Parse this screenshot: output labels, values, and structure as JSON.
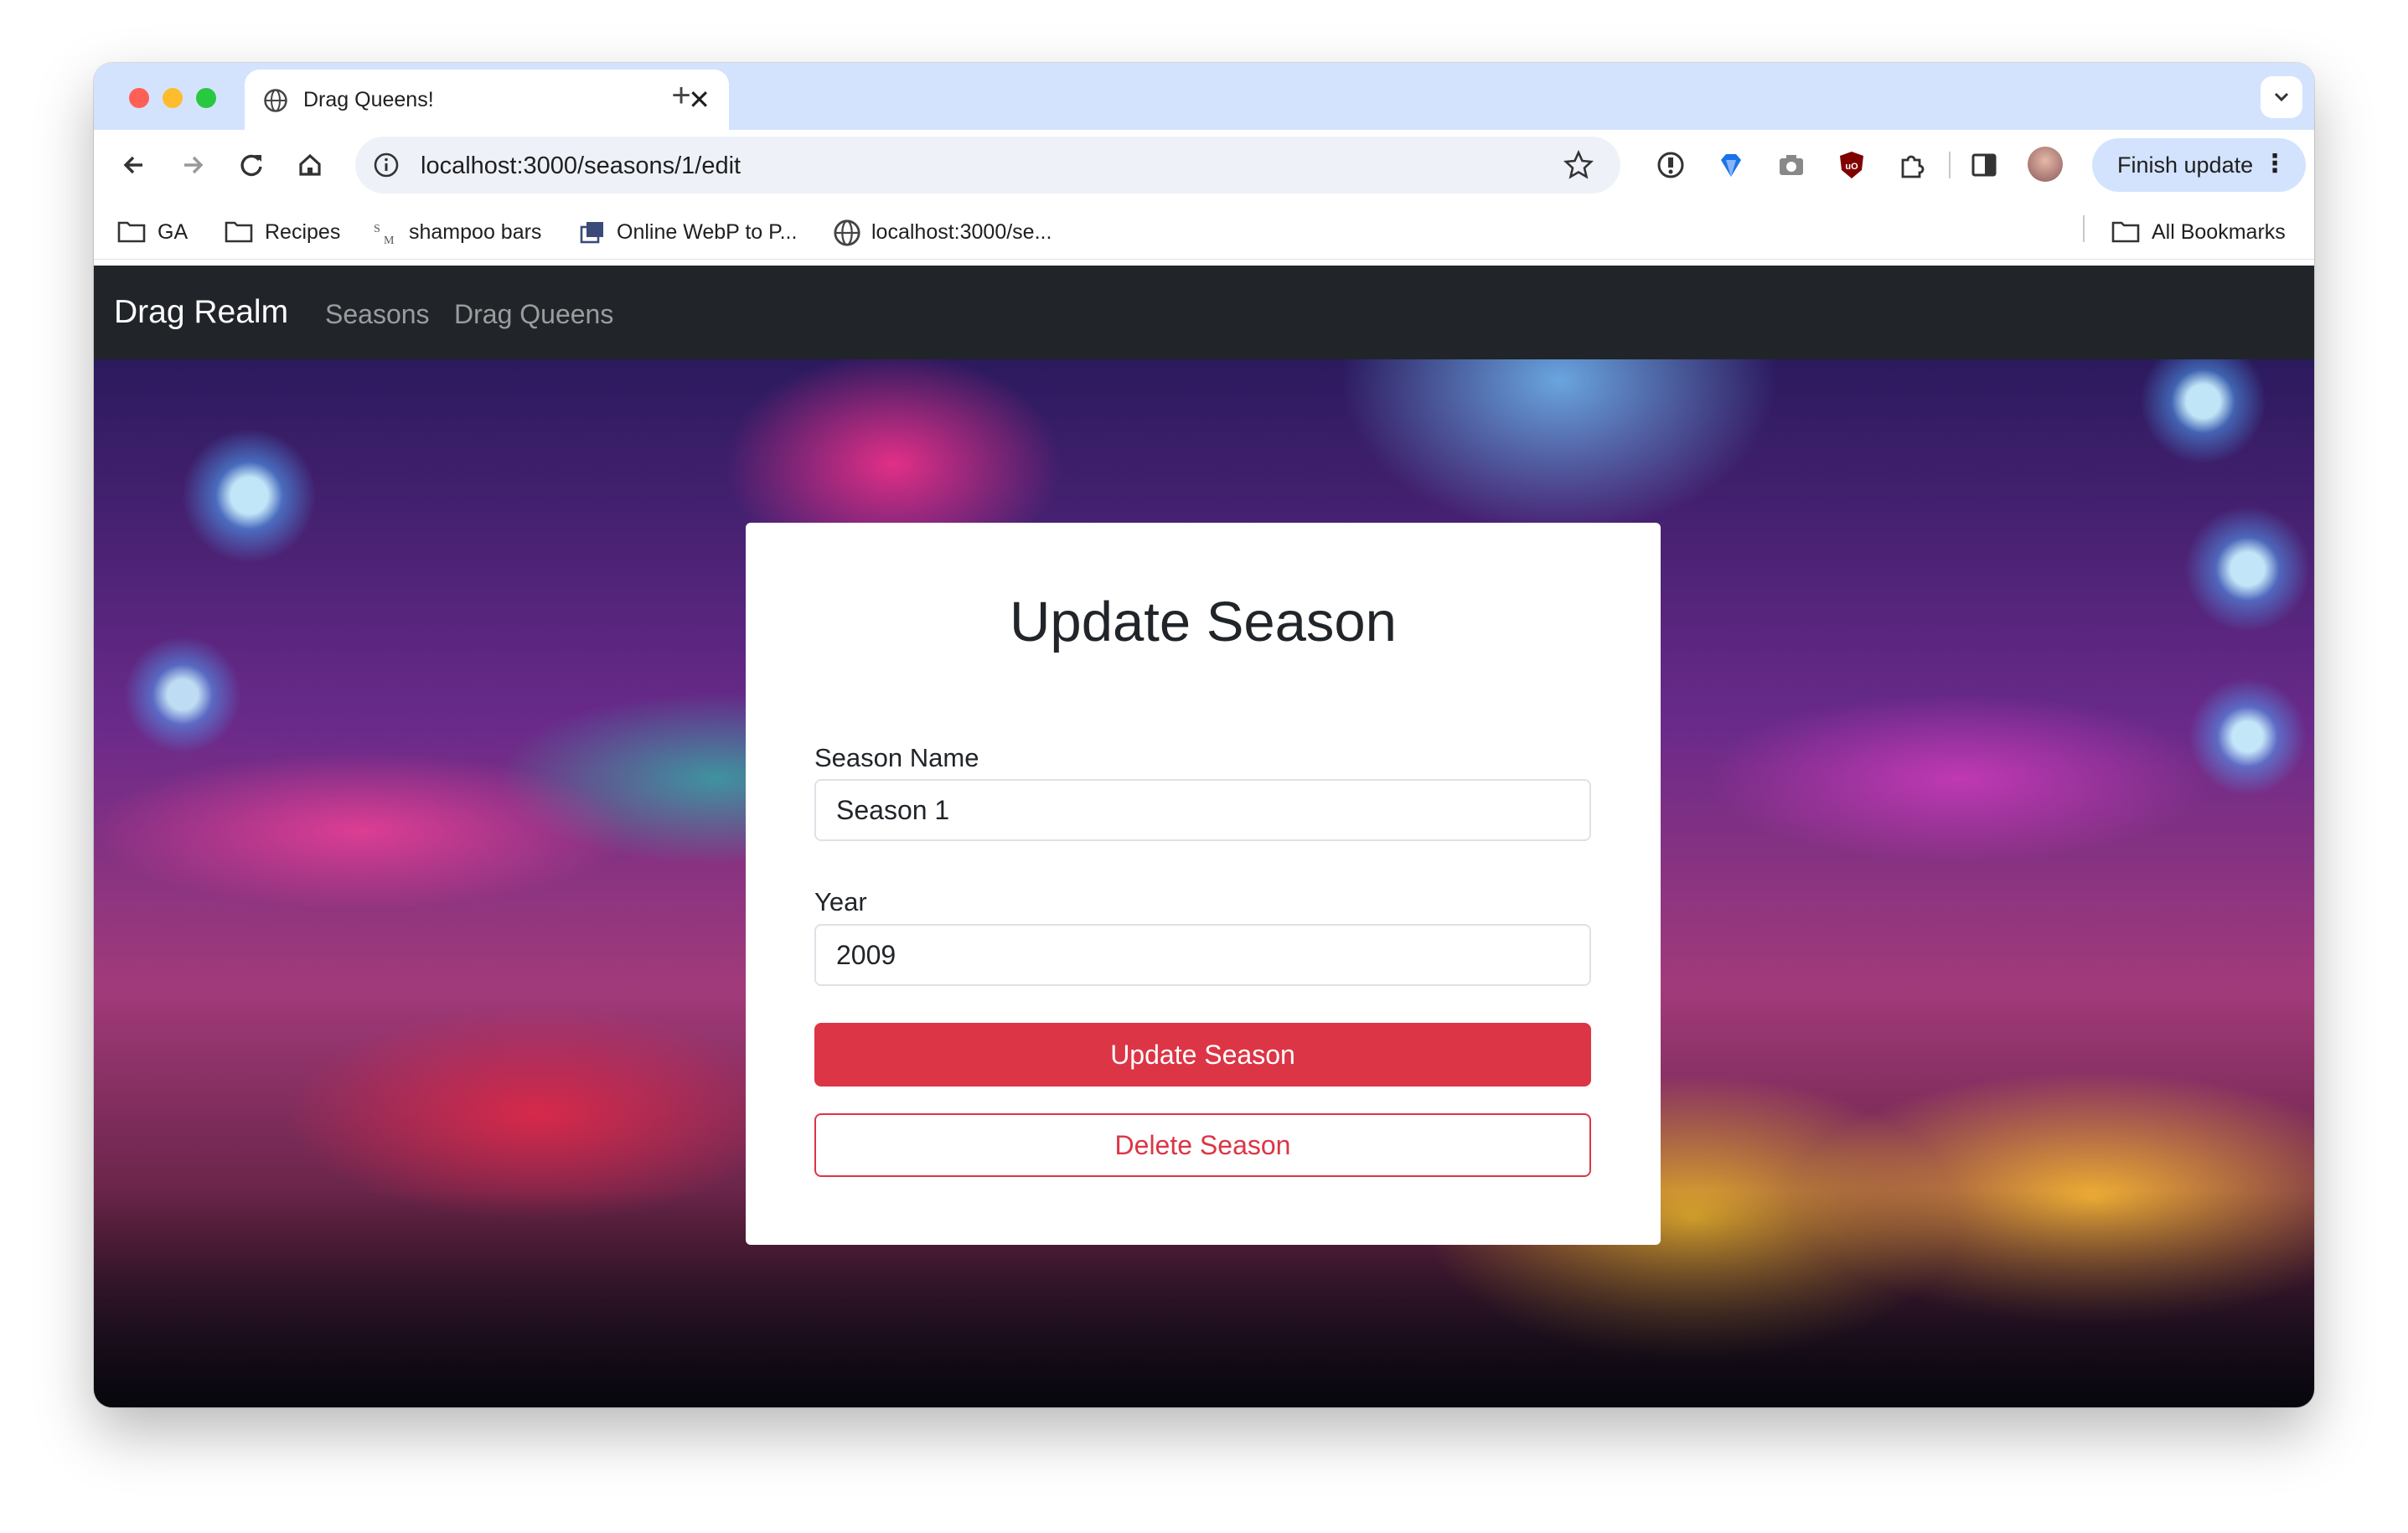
{
  "browser": {
    "tab_title": "Drag Queens!",
    "url": "localhost:3000/seasons/1/edit",
    "update_button_label": "Finish update",
    "bookmarks": [
      "GA",
      "Recipes",
      "shampoo bars",
      "Online WebP to P...",
      "localhost:3000/se..."
    ],
    "all_bookmarks_label": "All Bookmarks"
  },
  "app": {
    "brand": "Drag Realm",
    "nav": [
      "Seasons",
      "Drag Queens"
    ]
  },
  "form": {
    "heading": "Update Season",
    "season_name_label": "Season Name",
    "season_name_value": "Season 1",
    "year_label": "Year",
    "year_value": "2009",
    "submit_label": "Update Season",
    "delete_label": "Delete Season"
  },
  "colors": {
    "navbar_bg": "#212529",
    "danger": "#dc3545",
    "tabstrip_bg": "#d3e3fd"
  }
}
